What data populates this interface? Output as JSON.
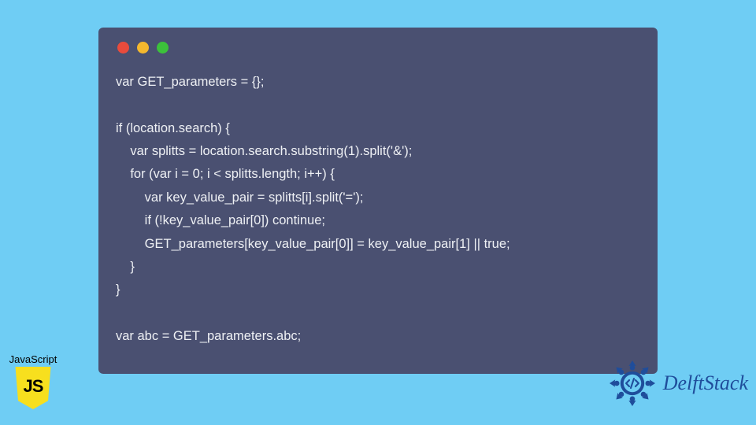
{
  "codeWindow": {
    "trafficLights": [
      "red",
      "yellow",
      "green"
    ],
    "lines": [
      "var GET_parameters = {};",
      "",
      "if (location.search) {",
      "    var splitts = location.search.substring(1).split('&');",
      "    for (var i = 0; i < splitts.length; i++) {",
      "        var key_value_pair = splitts[i].split('=');",
      "        if (!key_value_pair[0]) continue;",
      "        GET_parameters[key_value_pair[0]] = key_value_pair[1] || true;",
      "    }",
      "}",
      "",
      "var abc = GET_parameters.abc;"
    ]
  },
  "jsBadge": {
    "label": "JavaScript",
    "shieldText": "JS"
  },
  "delftStack": {
    "name": "DelftStack"
  },
  "colors": {
    "pageBg": "#6fcdf4",
    "windowBg": "#4a5071",
    "codeText": "#eef0f4",
    "jsYellow": "#f7df1e",
    "delftBlue": "#1f4d9b"
  }
}
